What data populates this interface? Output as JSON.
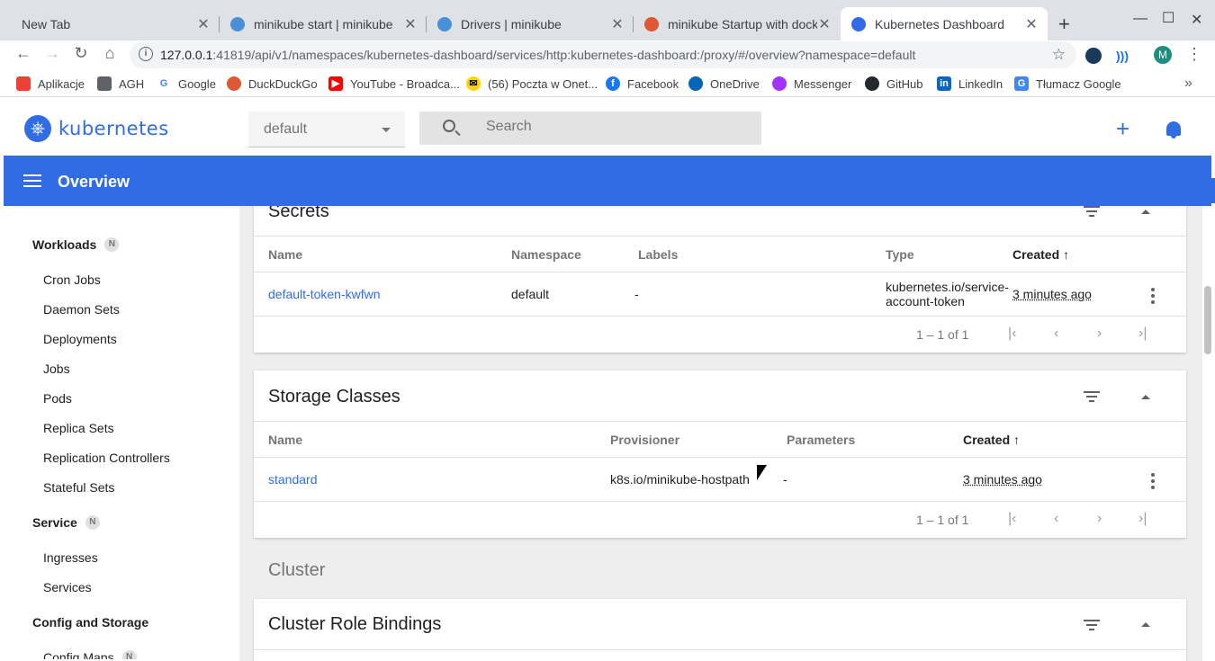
{
  "browser": {
    "tabs": [
      {
        "title": "New Tab",
        "active": false
      },
      {
        "title": "minikube start | minikube",
        "active": false
      },
      {
        "title": "Drivers | minikube",
        "active": false
      },
      {
        "title": "minikube Startup with docker",
        "active": false
      },
      {
        "title": "Kubernetes Dashboard",
        "active": true
      }
    ],
    "url_host": "127.0.0.1",
    "url_rest": ":41819/api/v1/namespaces/kubernetes-dashboard/services/http:kubernetes-dashboard:/proxy/#/overview?namespace=default",
    "profile_initial": "M",
    "bookmarks": [
      "Aplikacje",
      "AGH",
      "Google",
      "DuckDuckGo",
      "YouTube - Broadca...",
      "(56) Poczta w Onet...",
      "Facebook",
      "OneDrive",
      "Messenger",
      "GitHub",
      "LinkedIn",
      "Tłumacz Google"
    ],
    "more_bookmarks": "»"
  },
  "dashboard": {
    "logo_text": "kubernetes",
    "namespace": "default",
    "search_placeholder": "Search",
    "appbar_title": "Overview",
    "accent": "#326ce5"
  },
  "sidebar": {
    "workloads": {
      "label": "Workloads",
      "badge": "N"
    },
    "workload_items": [
      "Cron Jobs",
      "Daemon Sets",
      "Deployments",
      "Jobs",
      "Pods",
      "Replica Sets",
      "Replication Controllers",
      "Stateful Sets"
    ],
    "service": {
      "label": "Service",
      "badge": "N"
    },
    "service_items": [
      "Ingresses",
      "Services"
    ],
    "config": {
      "label": "Config and Storage"
    },
    "config_items": [
      {
        "label": "Config Maps",
        "badge": "N"
      }
    ]
  },
  "secrets": {
    "title": "Secrets",
    "columns": [
      "Name",
      "Namespace",
      "Labels",
      "Type",
      "Created"
    ],
    "sort_arrow": "↑",
    "rows": [
      {
        "name": "default-token-kwfwn",
        "namespace": "default",
        "labels": "-",
        "type_line1": "kubernetes.io/service-",
        "type_line2": "account-token",
        "created": "3 minutes ago"
      }
    ],
    "pagination": "1 – 1 of 1"
  },
  "storage_classes": {
    "title": "Storage Classes",
    "columns": [
      "Name",
      "Provisioner",
      "Parameters",
      "Created"
    ],
    "sort_arrow": "↑",
    "rows": [
      {
        "name": "standard",
        "provisioner": "k8s.io/minikube-hostpath",
        "parameters": "-",
        "created": "3 minutes ago"
      }
    ],
    "pagination": "1 – 1 of 1"
  },
  "cluster": {
    "section_title": "Cluster",
    "card_title": "Cluster Role Bindings"
  }
}
